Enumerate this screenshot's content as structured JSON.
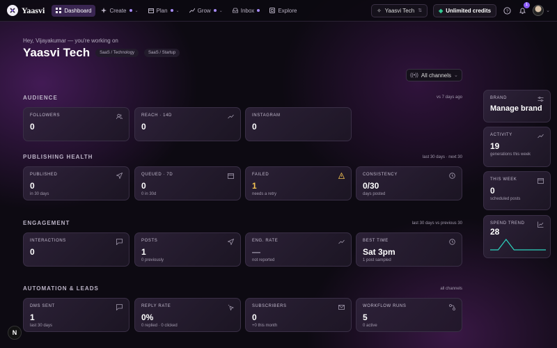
{
  "topbar": {
    "logo_text": "Yaasvi",
    "nav": [
      {
        "label": "Dashboard",
        "active": true,
        "dot": false,
        "chevron": false
      },
      {
        "label": "Create",
        "dot": true,
        "chevron": true
      },
      {
        "label": "Plan",
        "dot": true,
        "chevron": true
      },
      {
        "label": "Grow",
        "dot": true,
        "chevron": true
      },
      {
        "label": "Inbox",
        "dot": true,
        "chevron": false
      },
      {
        "label": "Explore",
        "dot": false,
        "chevron": false
      }
    ],
    "brand_select": "Yaasvi Tech",
    "credits": "Unlimited credits",
    "notifications_count": "1"
  },
  "header": {
    "greeting": "Hey, Vijayakumar — you're working on",
    "title": "Yaasvi Tech",
    "tags": [
      "SaaS / Technology",
      "SaaS / Startup"
    ],
    "channels_filter": "All channels"
  },
  "sections": {
    "audience": {
      "label": "AUDIENCE",
      "note": "vs 7 days ago",
      "cards": [
        {
          "label": "FOLLOWERS",
          "value": "0",
          "sub": ""
        },
        {
          "label": "REACH · 14D",
          "value": "0",
          "sub": ""
        },
        {
          "label": "INSTAGRAM",
          "value": "0",
          "sub": ""
        }
      ]
    },
    "publishing": {
      "label": "PUBLISHING HEALTH",
      "note": "last 30 days · next 30",
      "cards": [
        {
          "label": "PUBLISHED",
          "value": "0",
          "sub": "in 30 days"
        },
        {
          "label": "QUEUED · 7D",
          "value": "0",
          "sub": "0 in 30d"
        },
        {
          "label": "FAILED",
          "value": "1",
          "sub": "needs a retry"
        },
        {
          "label": "CONSISTENCY",
          "value": "0/30",
          "sub": "days posted"
        }
      ]
    },
    "engagement": {
      "label": "ENGAGEMENT",
      "note": "last 30 days vs previous 30",
      "cards": [
        {
          "label": "INTERACTIONS",
          "value": "0",
          "sub": ""
        },
        {
          "label": "POSTS",
          "value": "1",
          "sub": "0 previously"
        },
        {
          "label": "ENG. RATE",
          "value": "—",
          "sub": "not reported"
        },
        {
          "label": "BEST TIME",
          "value": "Sat 3pm",
          "sub": "1 post sampled"
        }
      ]
    },
    "automation": {
      "label": "AUTOMATION & LEADS",
      "note": "all channels",
      "cards": [
        {
          "label": "DMS SENT",
          "value": "1",
          "sub": "last 30 days"
        },
        {
          "label": "REPLY RATE",
          "value": "0%",
          "sub": "0 replied · 0 clicked"
        },
        {
          "label": "SUBSCRIBERS",
          "value": "0",
          "sub": "+0 this month"
        },
        {
          "label": "WORKFLOW RUNS",
          "value": "5",
          "sub": "0 active"
        }
      ]
    }
  },
  "sidebar": {
    "brand": {
      "label": "BRAND",
      "value": "Manage brand"
    },
    "activity": {
      "label": "ACTIVITY",
      "value": "19",
      "sub": "generations this week"
    },
    "this_week": {
      "label": "THIS WEEK",
      "value": "0",
      "sub": "scheduled posts"
    },
    "spend_trend": {
      "label": "SPEND TREND",
      "value": "28",
      "sparkline": [
        0,
        0,
        28,
        0,
        0,
        0,
        0,
        0
      ],
      "color": "#2dd4bf"
    }
  },
  "fab_label": "N"
}
